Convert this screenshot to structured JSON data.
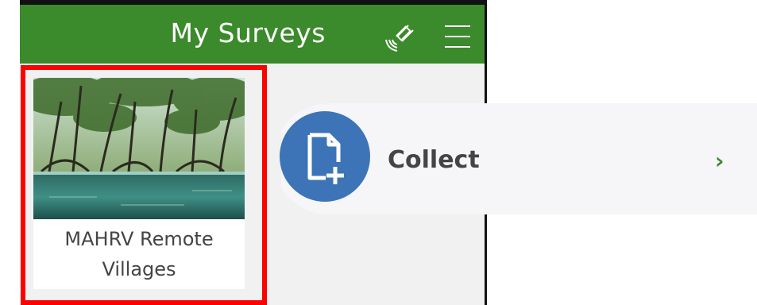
{
  "header": {
    "title": "My Surveys",
    "icons": [
      "satellite-icon",
      "menu-icon"
    ],
    "accent": "#3b8a2b"
  },
  "survey": {
    "name_line1": "MAHRV Remote",
    "name_line2": "Villages",
    "highlight_color": "#ff0000"
  },
  "action": {
    "label": "Collect",
    "icon": "new-document-icon",
    "circle_color": "#3d74b8",
    "chevron": "›"
  }
}
